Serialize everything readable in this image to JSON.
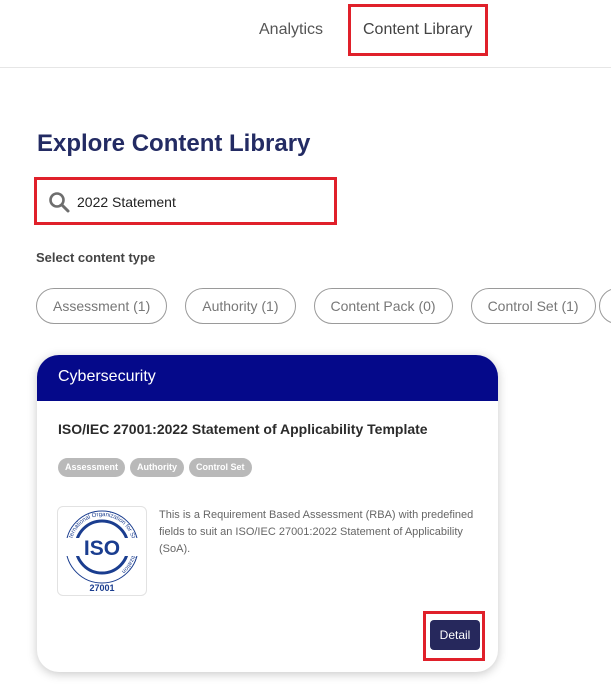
{
  "nav": {
    "analytics": "Analytics",
    "content_library": "Content Library"
  },
  "page": {
    "title": "Explore Content Library"
  },
  "search": {
    "value": "2022 Statement",
    "icon": "search-icon"
  },
  "filters": {
    "label": "Select content type",
    "chips": [
      "Assessment (1)",
      "Authority (1)",
      "Content Pack (0)",
      "Control Set (1)"
    ]
  },
  "card": {
    "category": "Cybersecurity",
    "title": "ISO/IEC 27001:2022 Statement of Applicability Template",
    "tags": [
      "Assessment",
      "Authority",
      "Control Set"
    ],
    "logo": {
      "ring_text": "International Organization for Standardization",
      "main_text": "ISO",
      "number": "27001"
    },
    "description": "This is a Requirement Based Assessment (RBA) with predefined fields to suit an ISO/IEC 27001:2022 Statement of Applicability (SoA).",
    "detail_label": "Detail"
  },
  "colors": {
    "brand_navy": "#05098a",
    "title_navy": "#232b63",
    "button_navy": "#26285c",
    "highlight_red": "#e0202a",
    "tag_gray": "#b9b9b9"
  }
}
